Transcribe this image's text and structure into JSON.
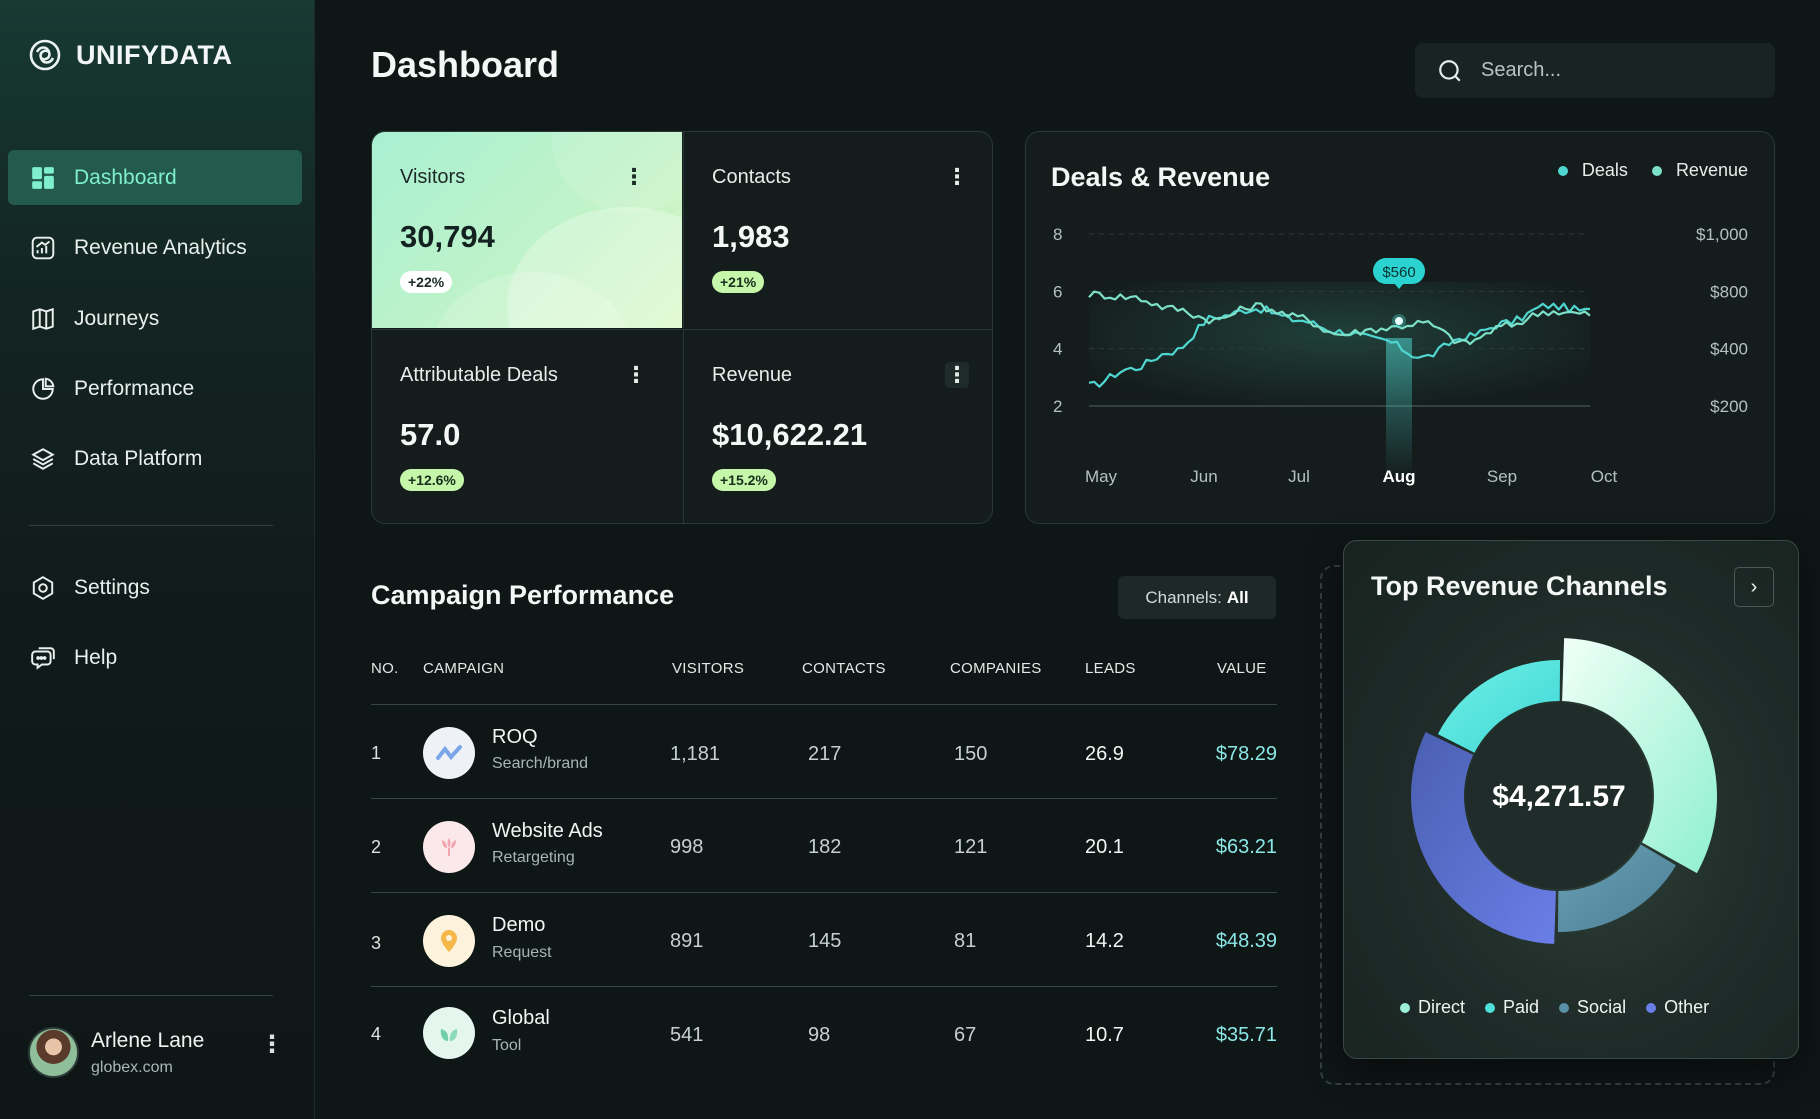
{
  "app": {
    "name": "UNIFYDATA"
  },
  "sidebar": {
    "items": [
      {
        "label": "Dashboard",
        "icon": "grid-icon",
        "active": true
      },
      {
        "label": "Revenue Analytics",
        "icon": "analytics-icon"
      },
      {
        "label": "Journeys",
        "icon": "map-icon"
      },
      {
        "label": "Performance",
        "icon": "pie-icon"
      },
      {
        "label": "Data Platform",
        "icon": "layers-icon"
      }
    ],
    "secondary": [
      {
        "label": "Settings",
        "icon": "settings-icon"
      },
      {
        "label": "Help",
        "icon": "help-icon"
      }
    ],
    "user": {
      "name": "Arlene Lane",
      "email": "globex.com"
    }
  },
  "header": {
    "title": "Dashboard",
    "search_placeholder": "Search..."
  },
  "stats": [
    {
      "label": "Visitors",
      "value": "30,794",
      "change": "+22%"
    },
    {
      "label": "Contacts",
      "value": "1,983",
      "change": "+21%"
    },
    {
      "label": "Attributable Deals",
      "value": "57.0",
      "change": "+12.6%"
    },
    {
      "label": "Revenue",
      "value": "$10,622.21",
      "change": "+15.2%"
    }
  ],
  "chart_data": {
    "type": "line",
    "title": "Deals & Revenue",
    "x": [
      "May",
      "Jun",
      "Jul",
      "Aug",
      "Sep",
      "Oct"
    ],
    "highlighted_x": "Aug",
    "y_left": {
      "ticks": [
        "8",
        "6",
        "4",
        "2"
      ],
      "range": [
        2,
        8
      ]
    },
    "y_right": {
      "ticks": [
        "$1,000",
        "$800",
        "$400",
        "$200"
      ]
    },
    "series": [
      {
        "name": "Deals",
        "color": "#4fd6d0",
        "values": [
          2.7,
          3.3,
          3.9,
          5.1,
          5.4,
          5.0,
          4.6,
          4.3,
          3.7,
          4.4,
          4.9,
          5.5,
          5.3
        ]
      },
      {
        "name": "Revenue",
        "color": "#7de0c8",
        "values": [
          5.9,
          5.8,
          5.4,
          5.0,
          5.5,
          5.1,
          4.5,
          4.7,
          4.9,
          4.2,
          4.8,
          5.3,
          5.2
        ]
      }
    ],
    "annotation": {
      "label": "$560",
      "x": "Aug"
    },
    "grid": true,
    "legend_position": "top-right"
  },
  "campaign": {
    "title": "Campaign Performance",
    "filter_label": "Channels:",
    "filter_value": "All",
    "columns": [
      "NO.",
      "CAMPAIGN",
      "VISITORS",
      "CONTACTS",
      "COMPANIES",
      "LEADS",
      "VALUE"
    ],
    "rows": [
      {
        "no": "1",
        "name": "ROQ",
        "sub": "Search/brand",
        "visitors": "1,181",
        "contacts": "217",
        "companies": "150",
        "leads": "26.9",
        "value": "$78.29",
        "icon": "roq-logo-icon"
      },
      {
        "no": "2",
        "name": "Website Ads",
        "sub": "Retargeting",
        "visitors": "998",
        "contacts": "182",
        "companies": "121",
        "leads": "20.1",
        "value": "$63.21",
        "icon": "tulip-logo-icon"
      },
      {
        "no": "3",
        "name": "Demo",
        "sub": "Request",
        "visitors": "891",
        "contacts": "145",
        "companies": "81",
        "leads": "14.2",
        "value": "$48.39",
        "icon": "pin-logo-icon"
      },
      {
        "no": "4",
        "name": "Global",
        "sub": "Tool",
        "visitors": "541",
        "contacts": "98",
        "companies": "67",
        "leads": "10.7",
        "value": "$35.71",
        "icon": "leaf-logo-icon"
      }
    ]
  },
  "revenue_channels": {
    "title": "Top Revenue Channels",
    "total": "$4,271.57",
    "legend": [
      {
        "name": "Direct",
        "color": "#9cf0d8"
      },
      {
        "name": "Paid",
        "color": "#4fe0dc"
      },
      {
        "name": "Social",
        "color": "#5a8fa8"
      },
      {
        "name": "Other",
        "color": "#6a7ee8"
      }
    ],
    "chart_data": {
      "type": "pie",
      "slices": [
        {
          "name": "Direct",
          "value": 33
        },
        {
          "name": "Social",
          "value": 17
        },
        {
          "name": "Other",
          "value": 32
        },
        {
          "name": "Paid",
          "value": 18
        }
      ]
    }
  }
}
